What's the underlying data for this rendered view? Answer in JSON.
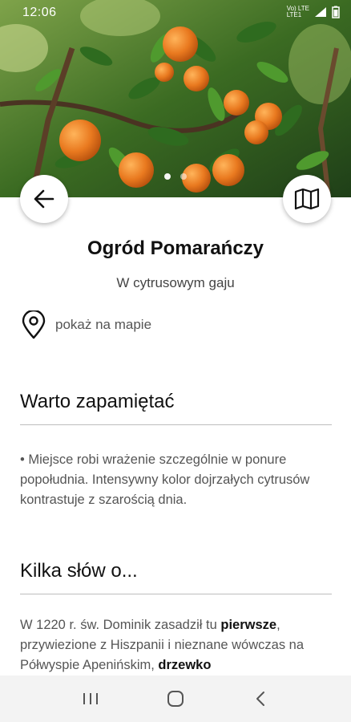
{
  "status_bar": {
    "time": "12:06",
    "network_top": "Vo) LTE",
    "network_bottom": "LTE1"
  },
  "header": {
    "back_icon": "arrow-left-icon",
    "map_icon": "folded-map-icon"
  },
  "place": {
    "title": "Ogród Pomarańczy",
    "subtitle": "W cytrusowym gaju",
    "show_on_map": "pokaż na mapie"
  },
  "sections": {
    "remember_heading": "Warto zapamiętać",
    "remember_text": "• Miejsce robi wrażenie szczególnie w ponure popołudnia. Intensywny kolor dojrzałych cytrusów kontrastuje z szarością dnia.",
    "about_heading": "Kilka słów o...",
    "about_text_1": "W 1220 r. św. Dominik zasadził tu ",
    "about_bold_1": "pierwsze",
    "about_text_2": ", przywiezione z Hiszpanii i nieznane wówczas na Półwyspie Apenińskim, ",
    "about_bold_2": "drzewko"
  },
  "colors": {
    "accent_orange": "#e9791f",
    "leaf_green": "#3e7a26"
  }
}
